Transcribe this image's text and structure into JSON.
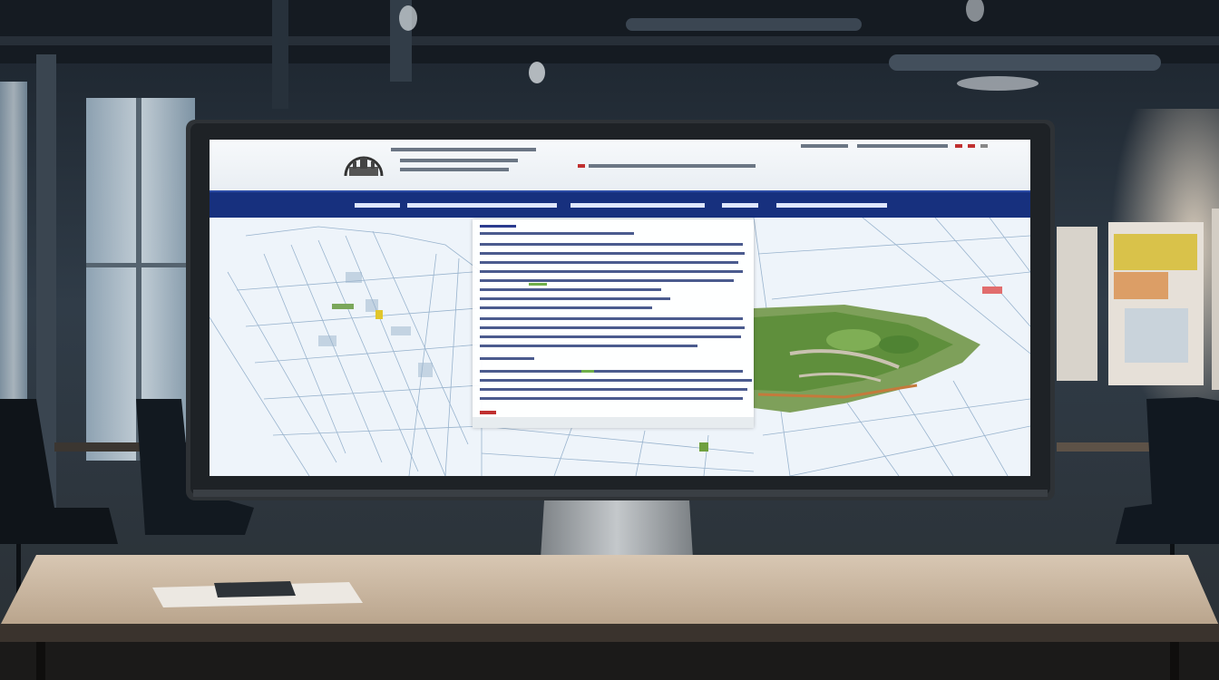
{
  "scene": {
    "description_kind": "photo",
    "palette": {
      "wall": "#2a3440",
      "ceiling": "#1d252e",
      "window": "#c8d9e6",
      "desk_top": "#cdbba6",
      "desk_edge": "#2b2724",
      "monitor_bezel": "#2e3236",
      "monitor_stand": "#9ea2a6",
      "nav_bar": "#17307e",
      "map_bg": "#eef4fa",
      "map_lines": "#7f9fbf",
      "forest": "#5f8f3c"
    }
  },
  "screen_page": {
    "logo_icon": "seal-logo-icon",
    "header_text_blurred": true,
    "nav_items_blurred": true,
    "panel_text_blurred": true
  }
}
